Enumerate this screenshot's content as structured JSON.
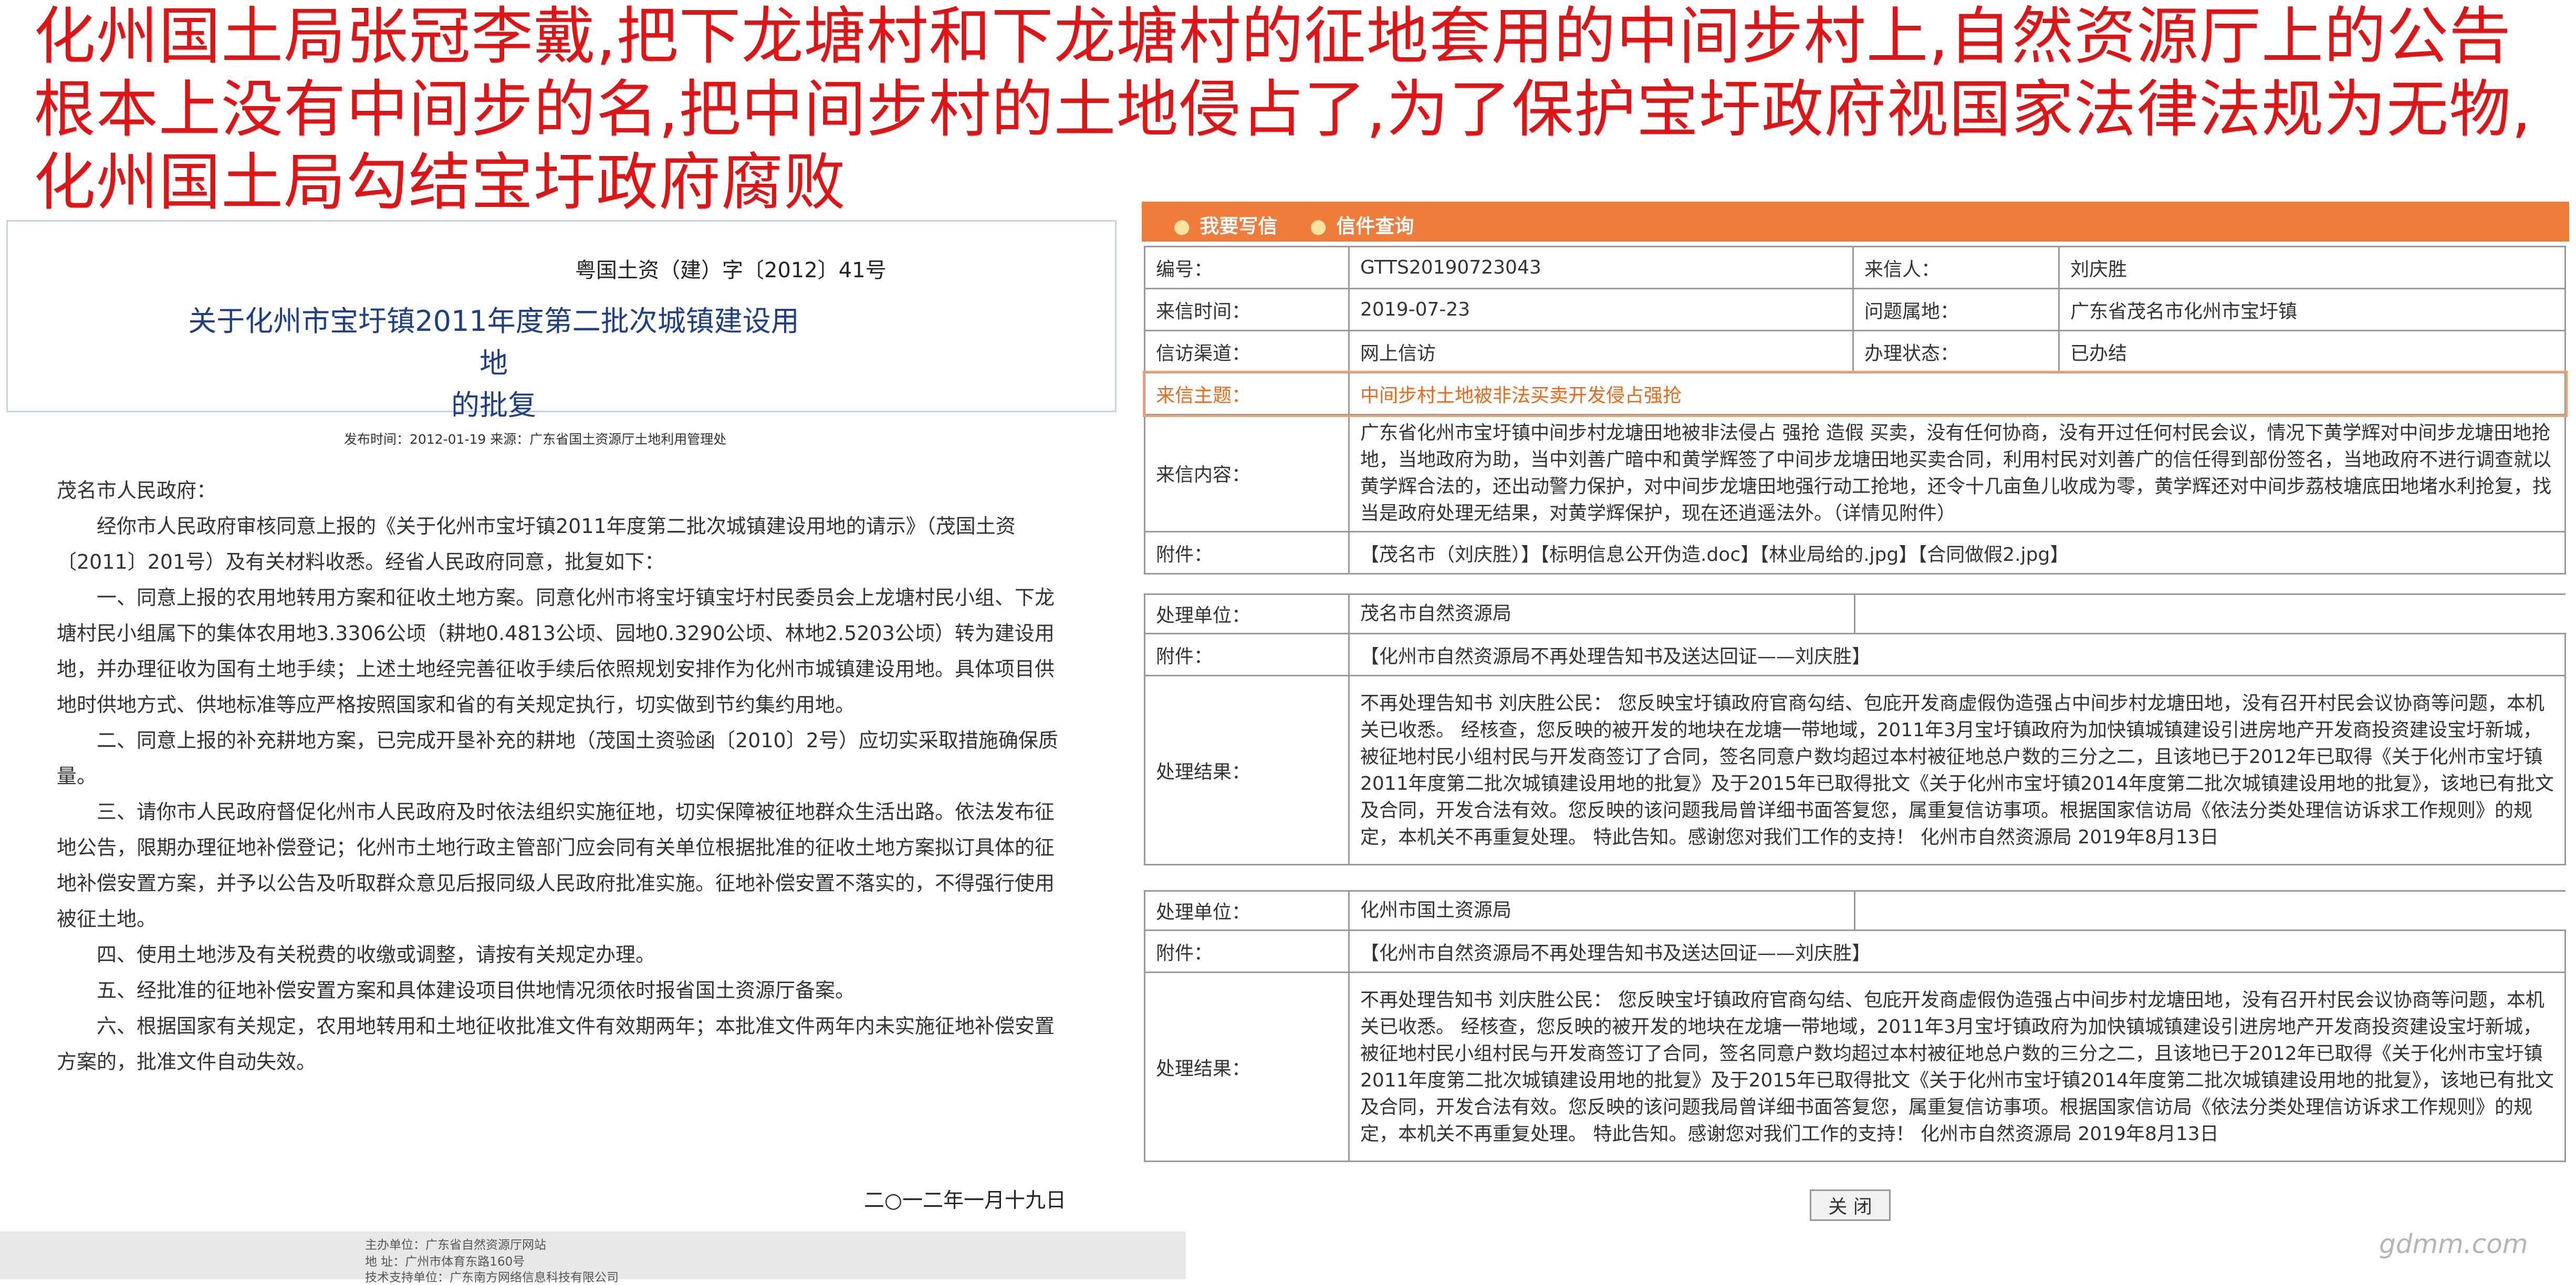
{
  "headline": "化州国土局张冠李戴,把下龙塘村和下龙塘村的征地套用的中间步村上,自然资源厅上的公告根本上没有中间步的名,把中间步村的土地侵占了,为了保护宝圩政府视国家法律法规为无物,化州国土局勾结宝圩政府腐败",
  "document": {
    "number": "粤国土资（建）字〔2012〕41号",
    "title_line1": "关于化州市宝圩镇2011年度第二批次城镇建设用地",
    "title_line2": "的批复",
    "meta": "发布时间：2012-01-19    来源：广东省国土资源厅土地利用管理处",
    "paragraphs": [
      "茂名市人民政府：",
      "经你市人民政府审核同意上报的《关于化州市宝圩镇2011年度第二批次城镇建设用地的请示》（茂国土资〔2011〕201号）及有关材料收悉。经省人民政府同意，批复如下：",
      "一、同意上报的农用地转用方案和征收土地方案。同意化州市将宝圩镇宝圩村民委员会上龙塘村民小组、下龙塘村民小组属下的集体农用地3.3306公顷（耕地0.4813公顷、园地0.3290公顷、林地2.5203公顷）转为建设用地，并办理征收为国有土地手续；上述土地经完善征收手续后依照规划安排作为化州市城镇建设用地。具体项目供地时供地方式、供地标准等应严格按照国家和省的有关规定执行，切实做到节约集约用地。",
      "二、同意上报的补充耕地方案，已完成开垦补充的耕地（茂国土资验函〔2010〕2号）应切实采取措施确保质量。",
      "三、请你市人民政府督促化州市人民政府及时依法组织实施征地，切实保障被征地群众生活出路。依法发布征地公告，限期办理征地补偿登记；化州市土地行政主管部门应会同有关单位根据批准的征收土地方案拟订具体的征地补偿安置方案，并予以公告及听取群众意见后报同级人民政府批准实施。征地补偿安置不落实的，不得强行使用被征土地。",
      "四、使用土地涉及有关税费的收缴或调整，请按有关规定办理。",
      "五、经批准的征地补偿安置方案和具体建设项目供地情况须依时报省国土资源厅备案。",
      "六、根据国家有关规定，农用地转用和土地征收批准文件有效期两年；本批准文件两年内未实施征地补偿安置方案的，批准文件自动失效。"
    ],
    "date": "二○一二年一月十九日",
    "footer": {
      "host": "主办单位：广东省自然资源厅网站",
      "address": "地 址：广州市体育东路160号",
      "tech": "技术支持单位：广东南方网络信息科技有限公司"
    }
  },
  "letter": {
    "tabs": [
      "我要写信",
      "信件查询"
    ],
    "rows": {
      "number_label": "编号：",
      "number_value": "GTTS20190723043",
      "sender_label": "来信人：",
      "sender_value": "刘庆胜",
      "time_label": "来信时间：",
      "time_value": "2019-07-23",
      "location_label": "问题属地：",
      "location_value": "广东省茂名市化州市宝圩镇",
      "channel_label": "信访渠道：",
      "channel_value": "网上信访",
      "status_label": "办理状态：",
      "status_value": "已办结",
      "subject_label": "来信主题：",
      "subject_value": "中间步村土地被非法买卖开发侵占强抢",
      "content_label": "来信内容：",
      "content_value": "广东省化州市宝圩镇中间步村龙塘田地被非法侵占 强抢 造假 买卖，没有任何协商，没有开过任何村民会议，情况下黄学辉对中间步龙塘田地抢地，当地政府为助，当中刘善广暗中和黄学辉签了中间步龙塘田地买卖合同，利用村民对刘善广的信任得到部份签名，当地政府不进行调查就以黄学辉合法的，还出动警力保护，对中间步龙塘田地强行动工抢地，还令十几亩鱼儿收成为零，黄学辉还对中间步荔枝塘底田地堵水利抢复，找当是政府处理无结果，对黄学辉保护，现在还逍遥法外。（详情见附件）",
      "attach_label": "附件：",
      "attach_value": "【茂名市（刘庆胜）】【标明信息公开伪造.doc】【林业局给的.jpg】【合同做假2.jpg】"
    },
    "results": [
      {
        "unit_label": "处理单位：",
        "unit_value": "茂名市自然资源局",
        "attach_label": "附件：",
        "attach_value": "【化州市自然资源局不再处理告知书及送达回证——刘庆胜】",
        "result_label": "处理结果：",
        "result_value": "不再处理告知书 刘庆胜公民： 您反映宝圩镇政府官商勾结、包庇开发商虚假伪造强占中间步村龙塘田地，没有召开村民会议协商等问题，本机关已收悉。 经核查，您反映的被开发的地块在龙塘一带地域，2011年3月宝圩镇政府为加快镇城镇建设引进房地产开发商投资建设宝圩新城，被征地村民小组村民与开发商签订了合同，签名同意户数均超过本村被征地总户数的三分之二，且该地已于2012年已取得《关于化州市宝圩镇2011年度第二批次城镇建设用地的批复》及于2015年已取得批文《关于化州市宝圩镇2014年度第二批次城镇建设用地的批复》，该地已有批文及合同，开发合法有效。您反映的该问题我局曾详细书面答复您，属重复信访事项。根据国家信访局《依法分类处理信访诉求工作规则》的规定，本机关不再重复处理。 特此告知。感谢您对我们工作的支持！ 化州市自然资源局 2019年8月13日"
      },
      {
        "unit_label": "处理单位：",
        "unit_value": "化州市国土资源局",
        "attach_label": "附件：",
        "attach_value": "【化州市自然资源局不再处理告知书及送达回证——刘庆胜】",
        "result_label": "处理结果：",
        "result_value": "不再处理告知书 刘庆胜公民： 您反映宝圩镇政府官商勾结、包庇开发商虚假伪造强占中间步村龙塘田地，没有召开村民会议协商等问题，本机关已收悉。 经核查，您反映的被开发的地块在龙塘一带地域，2011年3月宝圩镇政府为加快镇城镇建设引进房地产开发商投资建设宝圩新城，被征地村民小组村民与开发商签订了合同，签名同意户数均超过本村被征地总户数的三分之二，且该地已于2012年已取得《关于化州市宝圩镇2011年度第二批次城镇建设用地的批复》及于2015年已取得批文《关于化州市宝圩镇2014年度第二批次城镇建设用地的批复》，该地已有批文及合同，开发合法有效。您反映的该问题我局曾详细书面答复您，属重复信访事项。根据国家信访局《依法分类处理信访诉求工作规则》的规定，本机关不再重复处理。 特此告知。感谢您对我们工作的支持！ 化州市自然资源局 2019年8月13日"
      }
    ],
    "close_label": "关 闭"
  },
  "watermark": "gdmm.com",
  "colors": {
    "headline": "#e01414",
    "tab_bar": "#f07c3c",
    "subject": "#ea6a1a",
    "doc_title": "#1d3f8a"
  }
}
